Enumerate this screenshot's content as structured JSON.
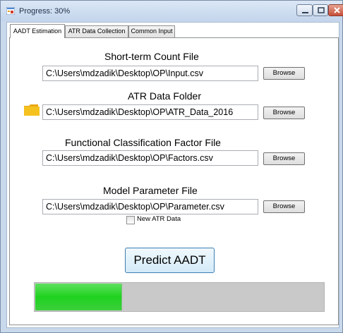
{
  "window": {
    "title": "Progress: 30%"
  },
  "tabs": [
    {
      "label": "AADT Estimation",
      "active": true
    },
    {
      "label": "ATR Data Collection",
      "active": false
    },
    {
      "label": "Common Input",
      "active": false
    }
  ],
  "sections": {
    "short_term": {
      "label": "Short-term Count File",
      "path": "C:\\Users\\mdzadik\\Desktop\\OP\\Input.csv",
      "button": "Browse"
    },
    "atr_folder": {
      "label": "ATR Data Folder",
      "path": "C:\\Users\\mdzadik\\Desktop\\OP\\ATR_Data_2016",
      "button": "Browse",
      "icon": "folder-icon"
    },
    "factor_file": {
      "label": "Functional Classification Factor File",
      "path": "C:\\Users\\mdzadik\\Desktop\\OP\\Factors.csv",
      "button": "Browse"
    },
    "model_param": {
      "label": "Model Parameter File",
      "path": "C:\\Users\\mdzadik\\Desktop\\OP\\Parameter.csv",
      "button": "Browse"
    }
  },
  "new_atr": {
    "label": "New ATR Data",
    "checked": false
  },
  "predict_button": "Predict AADT",
  "progress": {
    "fraction": 0.3,
    "color": "#22d022"
  }
}
